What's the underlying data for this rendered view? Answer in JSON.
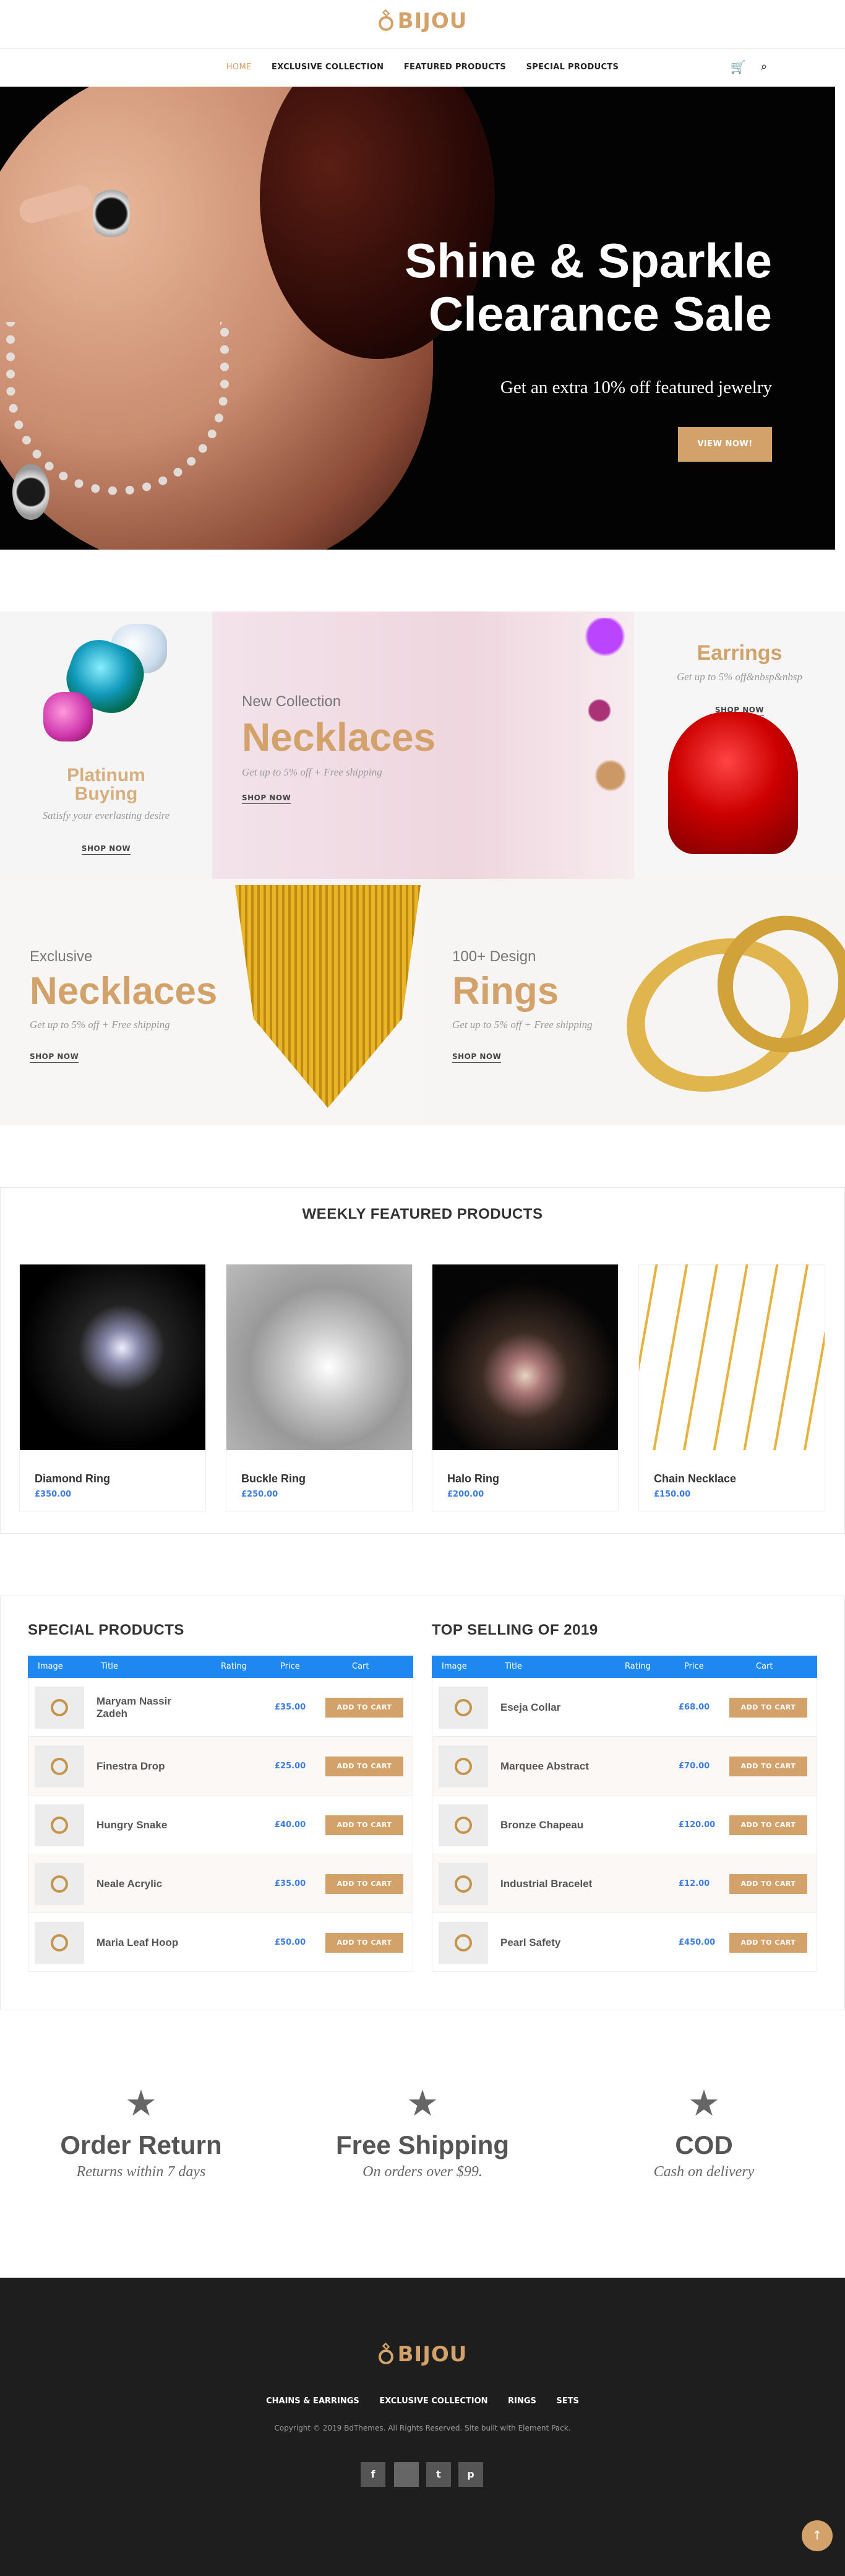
{
  "brand": {
    "name": "BIJOU",
    "color": "#d2a26a"
  },
  "nav": {
    "items": [
      "HOME",
      "EXCLUSIVE COLLECTION",
      "FEATURED PRODUCTS",
      "SPECIAL PRODUCTS"
    ],
    "active": "HOME"
  },
  "header_icons": {
    "cart": "cart-icon",
    "search": "search-icon"
  },
  "hero": {
    "title_line1": "Shine & Sparkle",
    "title_line2": "Clearance Sale",
    "subtitle": "Get an extra 10% off featured jewelry",
    "button": "VIEW NOW!"
  },
  "promos": {
    "platinum": {
      "title_line1": "Platinum",
      "title_line2": "Buying",
      "desc": "Satisfy your everlasting desire",
      "link": "SHOP NOW"
    },
    "necklaces_new": {
      "label": "New Collection",
      "title": "Necklaces",
      "desc": "Get up to 5% off + Free shipping",
      "link": "SHOP NOW"
    },
    "earrings": {
      "title": "Earrings",
      "desc": "Get up to 5% off&nbsp&nbsp",
      "link": "SHOP NOW"
    },
    "necklaces_excl": {
      "label": "Exclusive",
      "title": "Necklaces",
      "desc": "Get up to 5% off + Free shipping",
      "link": "SHOP NOW"
    },
    "rings": {
      "label": "100+ Design",
      "title": "Rings",
      "desc": "Get up to 5% off + Free shipping",
      "link": "SHOP NOW"
    }
  },
  "weekly": {
    "title": "WEEKLY FEATURED PRODUCTS",
    "products": [
      {
        "name": "Diamond Ring",
        "price": "£350.00"
      },
      {
        "name": "Buckle Ring",
        "price": "£250.00"
      },
      {
        "name": "Halo Ring",
        "price": "£200.00"
      },
      {
        "name": "Chain Necklace",
        "price": "£150.00"
      }
    ]
  },
  "special": {
    "title": "SPECIAL PRODUCTS",
    "columns": [
      "Image",
      "Title",
      "Rating",
      "Price",
      "Cart"
    ],
    "rows": [
      {
        "title": "Maryam Nassir Zadeh",
        "price": "£35.00",
        "cart": "ADD TO CART"
      },
      {
        "title": "Finestra Drop",
        "price": "£25.00",
        "cart": "ADD TO CART"
      },
      {
        "title": "Hungry Snake",
        "price": "£40.00",
        "cart": "ADD TO CART"
      },
      {
        "title": "Neale Acrylic",
        "price": "£35.00",
        "cart": "ADD TO CART"
      },
      {
        "title": "Maria Leaf Hoop",
        "price": "£50.00",
        "cart": "ADD TO CART"
      }
    ]
  },
  "topselling": {
    "title": "TOP SELLING OF 2019",
    "columns": [
      "Image",
      "Title",
      "Rating",
      "Price",
      "Cart"
    ],
    "rows": [
      {
        "title": "Eseja Collar",
        "price": "£68.00",
        "cart": "ADD TO CART"
      },
      {
        "title": "Marquee Abstract",
        "price": "£70.00",
        "cart": "ADD TO CART"
      },
      {
        "title": "Bronze Chapeau",
        "price": "£120.00",
        "cart": "ADD TO CART"
      },
      {
        "title": "Industrial Bracelet",
        "price": "£12.00",
        "cart": "ADD TO CART"
      },
      {
        "title": "Pearl Safety",
        "price": "£450.00",
        "cart": "ADD TO CART"
      }
    ]
  },
  "features": [
    {
      "icon": "star-icon",
      "title": "Order Return",
      "subtitle": "Returns within 7 days"
    },
    {
      "icon": "star-icon",
      "title": "Free Shipping",
      "subtitle": "On orders over $99."
    },
    {
      "icon": "star-icon",
      "title": "COD",
      "subtitle": "Cash on delivery"
    }
  ],
  "footer": {
    "brand": "BIJOU",
    "nav": [
      "CHAINS & EARRINGS",
      "EXCLUSIVE COLLECTION",
      "RINGS",
      "SETS"
    ],
    "copyright": "Copyright © 2019 BdThemes. All Rights Reserved. Site built with Element Pack.",
    "social": [
      {
        "icon": "facebook-icon",
        "glyph": "f"
      },
      {
        "icon": "google-icon",
        "glyph": ""
      },
      {
        "icon": "twitter-icon",
        "glyph": "t"
      },
      {
        "icon": "pinterest-icon",
        "glyph": "p"
      }
    ],
    "totop": "↑"
  }
}
